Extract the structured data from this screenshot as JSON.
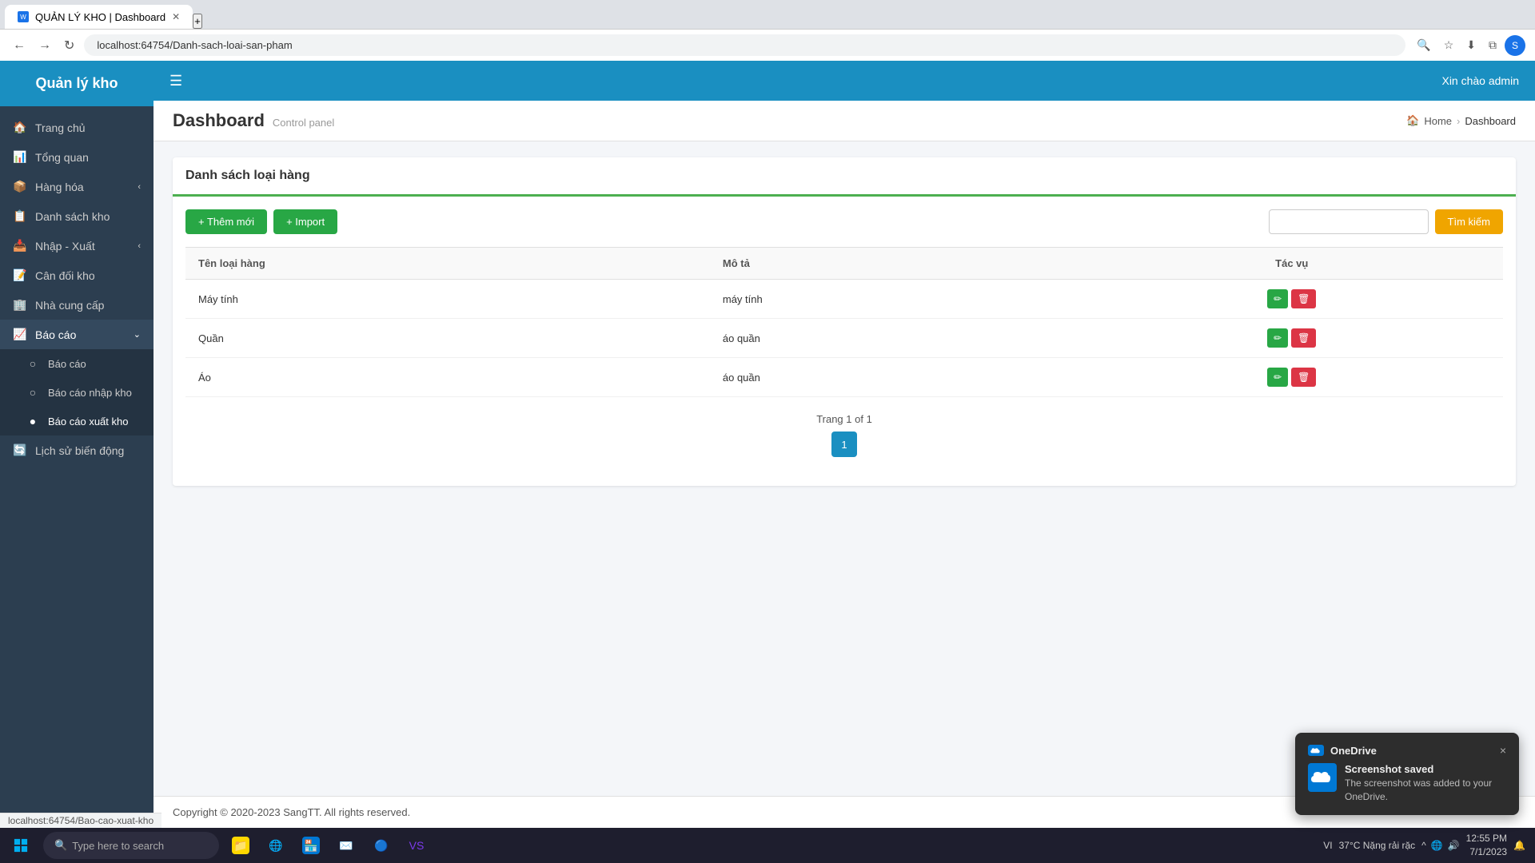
{
  "browser": {
    "tab_title": "QUẢN LÝ KHO | Dashboard",
    "url": "localhost:64754/Danh-sach-loai-san-pham",
    "status_url": "localhost:64754/Bao-cao-xuat-kho"
  },
  "header": {
    "hamburger": "☰",
    "welcome": "Xin chào admin"
  },
  "sidebar": {
    "brand": "Quản lý kho",
    "items": [
      {
        "id": "trang-chu",
        "label": "Trang chủ",
        "icon": "🏠",
        "has_arrow": false
      },
      {
        "id": "tong-quan",
        "label": "Tổng quan",
        "icon": "📊",
        "has_arrow": false
      },
      {
        "id": "hang-hoa",
        "label": "Hàng hóa",
        "icon": "📦",
        "has_arrow": true
      },
      {
        "id": "danh-sach-kho",
        "label": "Danh sách kho",
        "icon": "📋",
        "has_arrow": false
      },
      {
        "id": "nhap-xuat",
        "label": "Nhập - Xuất",
        "icon": "📥",
        "has_arrow": true
      },
      {
        "id": "can-doi-kho",
        "label": "Cân đối kho",
        "icon": "📝",
        "has_arrow": false
      },
      {
        "id": "nha-cung-cap",
        "label": "Nhà cung cấp",
        "icon": "🏢",
        "has_arrow": false
      },
      {
        "id": "bao-cao",
        "label": "Báo cáo",
        "icon": "📈",
        "has_arrow": true,
        "active": true
      }
    ],
    "submenu": [
      {
        "id": "bao-cao-sub",
        "label": "Báo cáo",
        "active": false
      },
      {
        "id": "bao-cao-nhap-kho",
        "label": "Báo cáo nhập kho",
        "active": false
      },
      {
        "id": "bao-cao-xuat-kho",
        "label": "Báo cáo xuất kho",
        "active": true
      }
    ],
    "extra_items": [
      {
        "id": "lich-su-bien-dong",
        "label": "Lịch sử biến động",
        "icon": "🔄"
      }
    ]
  },
  "content": {
    "title": "Dashboard",
    "subtitle": "Control panel",
    "breadcrumb_home": "Home",
    "breadcrumb_current": "Dashboard",
    "card_title": "Danh sách loại hàng",
    "btn_add": "+ Thêm mới",
    "btn_import": "+ Import",
    "btn_search": "Tìm kiếm",
    "search_placeholder": "",
    "table": {
      "col1": "Tên loại hàng",
      "col2": "Mô tả",
      "col3": "Tác vụ",
      "rows": [
        {
          "id": 1,
          "name": "Máy tính",
          "description": "máy tính"
        },
        {
          "id": 2,
          "name": "Quần",
          "description": "áo quần"
        },
        {
          "id": 3,
          "name": "Áo",
          "description": "áo quần"
        }
      ]
    },
    "pagination": {
      "info": "Trang 1 of 1",
      "page": "1"
    }
  },
  "footer": {
    "text": "Copyright © 2020-2023 SangTT.",
    "rights": " All rights reserved."
  },
  "taskbar": {
    "search_placeholder": "Type here to search",
    "time": "12:55 PM",
    "date": "7/1/2023",
    "language": "VI",
    "weather": "37°C Nặng rải rặc"
  },
  "onedrive": {
    "app_name": "OneDrive",
    "title": "Screenshot saved",
    "body": "The screenshot was added to your OneDrive.",
    "close_label": "×"
  }
}
